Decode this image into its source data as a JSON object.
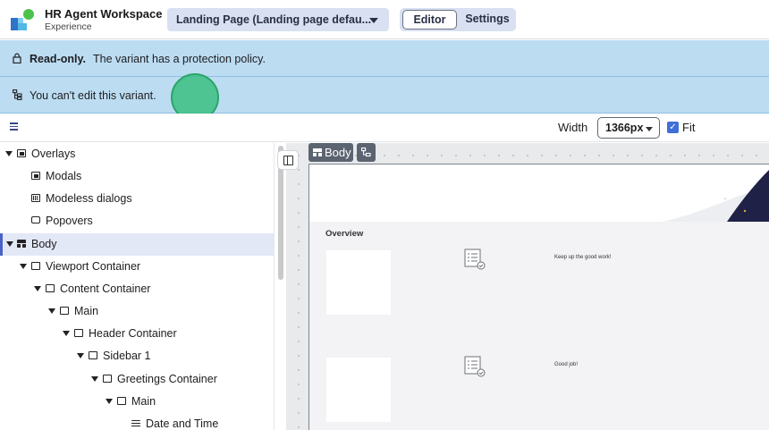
{
  "app": {
    "title": "HR Agent Workspace",
    "subtitle": "Experience",
    "page_selector": "Landing Page (Landing page defau...",
    "tabs": [
      {
        "label": "Editor",
        "active": true
      },
      {
        "label": "Settings",
        "active": false
      }
    ]
  },
  "banners": {
    "readonly_title": "Read-only.",
    "readonly_message": "The variant has a protection policy.",
    "edit_message": "You can't edit this variant."
  },
  "toolbar": {
    "width_label": "Width",
    "width_value": "1366px",
    "fit_label": "Fit",
    "fit_checked": true
  },
  "tree": [
    {
      "label": "Overlays",
      "icon": "overlay-icon",
      "expanded": true
    },
    {
      "label": "Modals",
      "icon": "modal-icon"
    },
    {
      "label": "Modeless dialogs",
      "icon": "dialog-icon"
    },
    {
      "label": "Popovers",
      "icon": "popover-icon"
    },
    {
      "label": "Body",
      "icon": "layout-icon",
      "expanded": true,
      "selected": true
    },
    {
      "label": "Viewport Container",
      "icon": "container-icon",
      "expanded": true
    },
    {
      "label": "Content Container",
      "icon": "container-icon",
      "expanded": true
    },
    {
      "label": "Main",
      "icon": "container-icon",
      "expanded": true
    },
    {
      "label": "Header Container",
      "icon": "container-icon",
      "expanded": true
    },
    {
      "label": "Sidebar 1",
      "icon": "container-icon",
      "expanded": true
    },
    {
      "label": "Greetings Container",
      "icon": "container-icon",
      "expanded": true
    },
    {
      "label": "Main",
      "icon": "container-icon",
      "expanded": true
    },
    {
      "label": "Date and Time",
      "icon": "text-icon"
    }
  ],
  "canvas": {
    "body_tag": "Body",
    "section_title": "Overview",
    "messages": [
      "Keep up the good work!",
      "Good job!"
    ]
  }
}
